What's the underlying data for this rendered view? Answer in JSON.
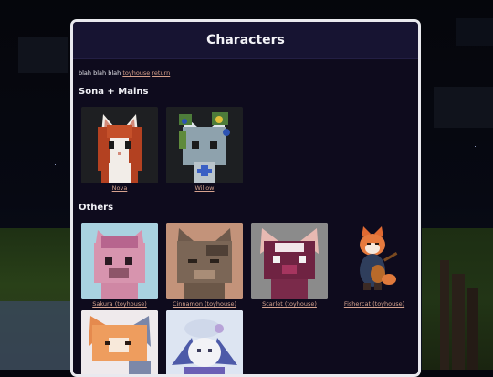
{
  "page": {
    "title": "Characters"
  },
  "intro": {
    "text": "blah blah blah",
    "link_toyhouse": "toyhouse",
    "link_return": "return"
  },
  "sections": [
    {
      "title": "Sona + Mains",
      "characters": [
        {
          "name": "Nova",
          "icon": "orange-cat-portrait"
        },
        {
          "name": "Willow",
          "icon": "grey-cat-flower-crown-portrait"
        }
      ]
    },
    {
      "title": "Others",
      "characters": [
        {
          "name": "Sakura (toyhouse)",
          "icon": "pink-cat-portrait"
        },
        {
          "name": "Cinnamon (toyhouse)",
          "icon": "brown-cat-portrait"
        },
        {
          "name": "Scarlet (toyhouse)",
          "icon": "magenta-cat-portrait"
        },
        {
          "name": "Fishercat (toyhouse)",
          "icon": "fox-guitar-portrait"
        },
        {
          "name": "",
          "icon": "orange-fox-portrait"
        },
        {
          "name": "",
          "icon": "white-creature-portrait"
        }
      ]
    }
  ]
}
